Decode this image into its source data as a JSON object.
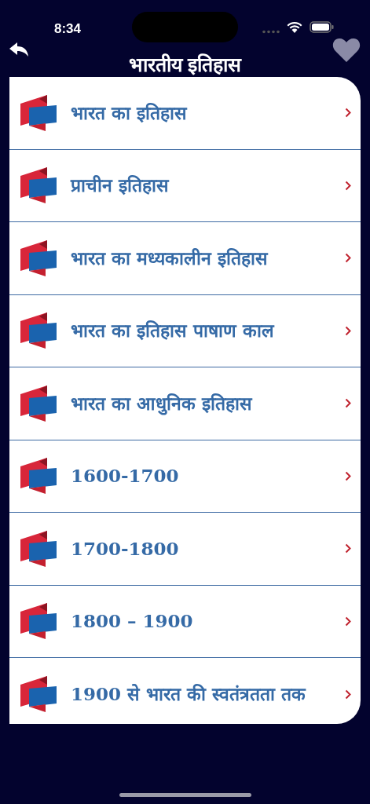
{
  "status_bar": {
    "time": "8:34"
  },
  "header": {
    "title": "भारतीय इतिहास",
    "favorite": false
  },
  "items": [
    {
      "label": "भारत का इतिहास"
    },
    {
      "label": "प्राचीन इतिहास"
    },
    {
      "label": "भारत का मध्यकालीन इतिहास"
    },
    {
      "label": "भारत का इतिहास पाषाण काल"
    },
    {
      "label": "भारत का आधुनिक इतिहास"
    },
    {
      "label": "1600-1700"
    },
    {
      "label": "1700-1800"
    },
    {
      "label": "1800 – 1900"
    },
    {
      "label": "1900 से भारत की स्वतंत्रतता तक"
    }
  ]
}
